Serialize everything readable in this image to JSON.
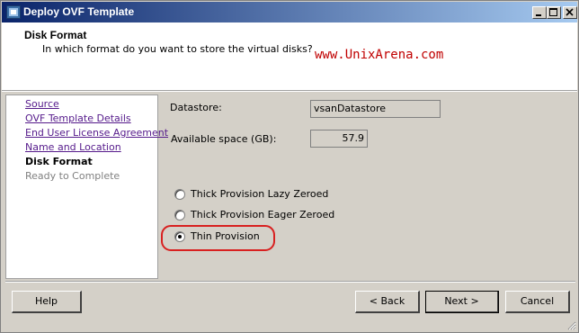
{
  "window": {
    "title": "Deploy OVF Template"
  },
  "header": {
    "title": "Disk Format",
    "subtitle": "In which format do you want to store the virtual disks?",
    "watermark": "www.UnixArena.com"
  },
  "nav": {
    "items": [
      {
        "label": "Source",
        "state": "link"
      },
      {
        "label": "OVF Template Details",
        "state": "link"
      },
      {
        "label": "End User License Agreement",
        "state": "link"
      },
      {
        "label": "Name and Location",
        "state": "link"
      },
      {
        "label": "Disk Format",
        "state": "current"
      },
      {
        "label": "Ready to Complete",
        "state": "disabled"
      }
    ]
  },
  "content": {
    "datastore_label": "Datastore:",
    "datastore_value": "vsanDatastore",
    "space_label": "Available space (GB):",
    "space_value": "57.9",
    "options": [
      {
        "label": "Thick Provision Lazy Zeroed",
        "selected": false
      },
      {
        "label": "Thick Provision Eager Zeroed",
        "selected": false
      },
      {
        "label": "Thin Provision",
        "selected": true
      }
    ]
  },
  "footer": {
    "help": "Help",
    "back": "< Back",
    "next": "Next >",
    "cancel": "Cancel"
  },
  "colors": {
    "highlight": "#d82020",
    "titlebar": "#0a246a"
  }
}
